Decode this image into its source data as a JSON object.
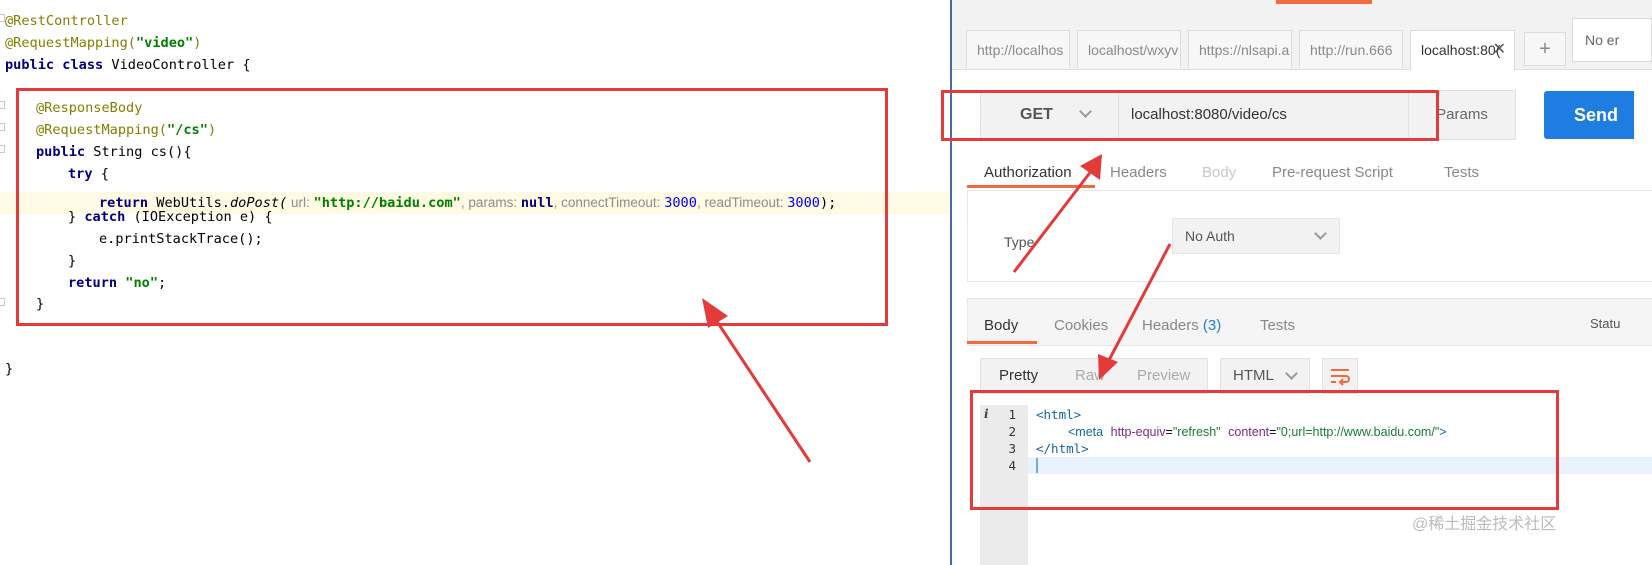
{
  "ide": {
    "lines": {
      "l1": "@RestController",
      "l2a": "@RequestMapping(",
      "l2b": "\"video\"",
      "l2c": ")",
      "l3a": "public class",
      "l3b": " VideoController {",
      "l5": "@ResponseBody",
      "l6a": "@RequestMapping(",
      "l6b": "\"/cs\"",
      "l6c": ")",
      "l7a": "public",
      "l7b": " String cs(){",
      "l8a": "try",
      "l8b": " {",
      "l9_return": "return",
      "l9_call": " WebUtils.",
      "l9_method": "doPost(",
      "l9_hint_url": " url: ",
      "l9_url": "\"http://baidu.com\"",
      "l9_hint_params": ", params: ",
      "l9_null": "null",
      "l9_hint_ct": ", connectTimeout: ",
      "l9_ct": "3000",
      "l9_hint_rt": ", readTimeout: ",
      "l9_rt": "3000",
      "l9_end": ");",
      "l10a": "} ",
      "l10b": "catch",
      "l10c": " (IOException e) {",
      "l11": "e.printStackTrace();",
      "l12": "}",
      "l13a": "return",
      "l13b": " ",
      "l13c": "\"no\"",
      "l13d": ";",
      "l14": "}",
      "l17": "}"
    }
  },
  "postman": {
    "tabs": [
      {
        "label": "http://localhos"
      },
      {
        "label": "localhost/wxyv"
      },
      {
        "label": "https://nlsapi.a"
      },
      {
        "label": "http://run.666"
      },
      {
        "label": "localhost:80("
      }
    ],
    "tab_close": "✕",
    "tab_add": "+",
    "environment": "No er",
    "request": {
      "method": "GET",
      "url": "localhost:8080/video/cs",
      "params_label": "Params",
      "send_label": "Send"
    },
    "request_tabs": [
      "Authorization",
      "Headers",
      "Body",
      "Pre-request Script",
      "Tests"
    ],
    "auth": {
      "type_label": "Type",
      "type_value": "No Auth"
    },
    "response_tabs": {
      "body": "Body",
      "cookies": "Cookies",
      "headers": "Headers",
      "headers_count": "(3)",
      "tests": "Tests",
      "status": "Statu"
    },
    "view_modes": [
      "Pretty",
      "Raw",
      "Preview"
    ],
    "format": "HTML",
    "info_icon": "i",
    "response_lines": [
      "1",
      "2",
      "3",
      "4"
    ],
    "response_code": {
      "r1": "<html>",
      "r2_tag_open": "<meta",
      "r2_attr1": "http-equiv",
      "r2_val1": "\"refresh\"",
      "r2_attr2": "content",
      "r2_val2": "\"0;url=http://www.baidu.com/\"",
      "r2_close": ">",
      "eq": "=",
      "r3": "</html>"
    },
    "watermark": "@稀土掘金技术社区"
  },
  "colors": {
    "annotation_red": "#e53a3a",
    "send_blue": "#1f7de1",
    "postman_orange": "#f26b3a"
  }
}
